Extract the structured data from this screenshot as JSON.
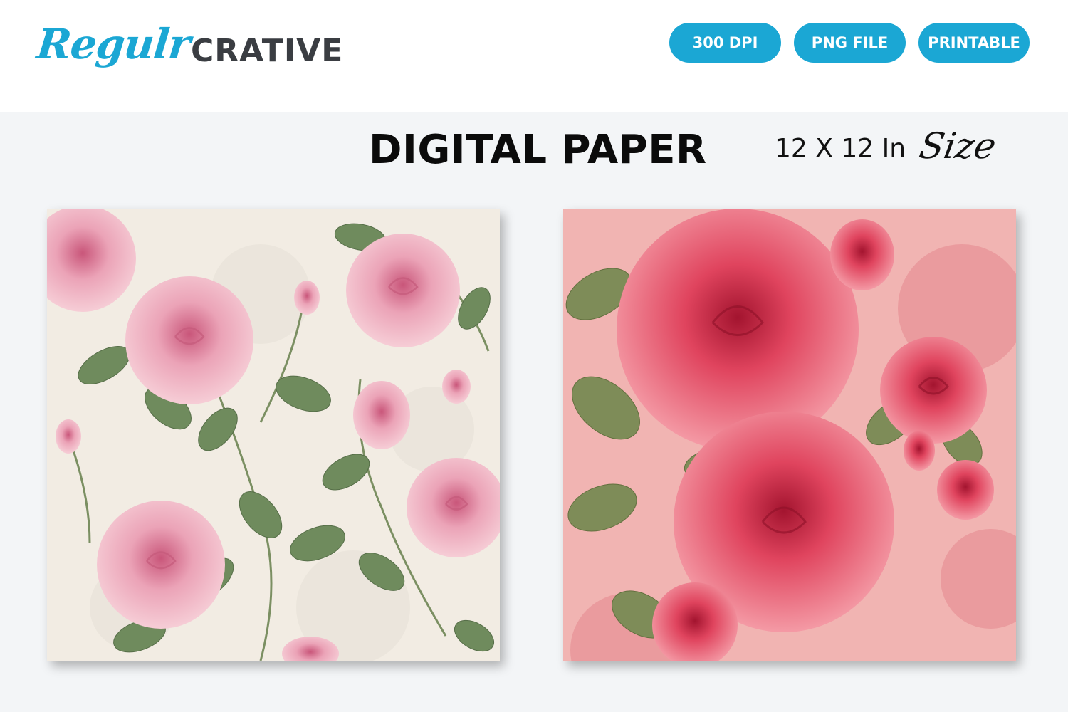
{
  "brand": {
    "script": "Regulr",
    "bold": "CRATIVE"
  },
  "badges": [
    "300 DPI",
    "PNG FILE",
    "PRINTABLE"
  ],
  "title": "DIGITAL PAPER",
  "size": {
    "text": "12 X 12 In",
    "script": "Size"
  },
  "colors": {
    "accent": "#1ba7d4",
    "logo_dark": "#3a3d42"
  },
  "panels": [
    {
      "name": "pale-pink-roses-paper"
    },
    {
      "name": "red-pink-roses-paper"
    }
  ]
}
